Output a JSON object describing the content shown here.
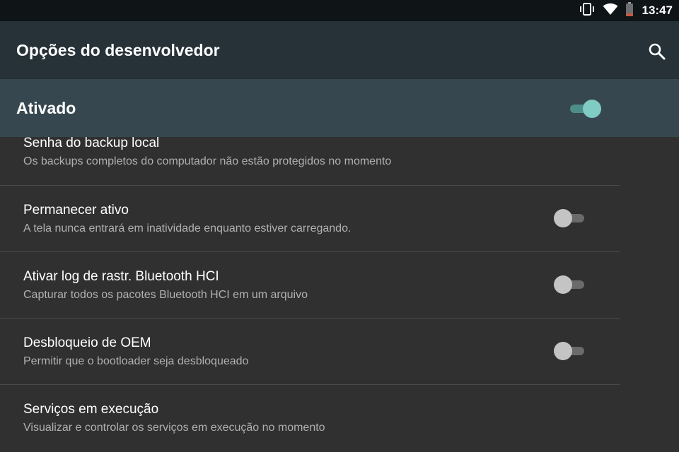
{
  "status_bar": {
    "icons": [
      "vibrate-icon",
      "wifi-icon",
      "battery-icon"
    ],
    "time": "13:47"
  },
  "app_bar": {
    "title": "Opções do desenvolvedor",
    "search_icon": "search-icon"
  },
  "master_switch": {
    "label": "Ativado",
    "enabled": true
  },
  "settings": [
    {
      "title": "Senha do backup local",
      "subtitle": "Os backups completos do computador não estão protegidos no momento"
    },
    {
      "title": "Permanecer ativo",
      "subtitle": "A tela nunca entrará em inatividade enquanto estiver carregando.",
      "toggle": false
    },
    {
      "title": "Ativar log de rastr. Bluetooth HCI",
      "subtitle": "Capturar todos os pacotes Bluetooth HCI em um arquivo",
      "toggle": false
    },
    {
      "title": "Desbloqueio de OEM",
      "subtitle": "Permitir que o bootloader seja desbloqueado",
      "toggle": false
    },
    {
      "title": "Serviços em execução",
      "subtitle": "Visualizar e controlar os serviços em execução no momento"
    }
  ],
  "colors": {
    "status_bar": "#0f1416",
    "app_bar": "#263238",
    "master_bar": "#37474f",
    "background": "#303030",
    "accent": "#80cbc4"
  }
}
